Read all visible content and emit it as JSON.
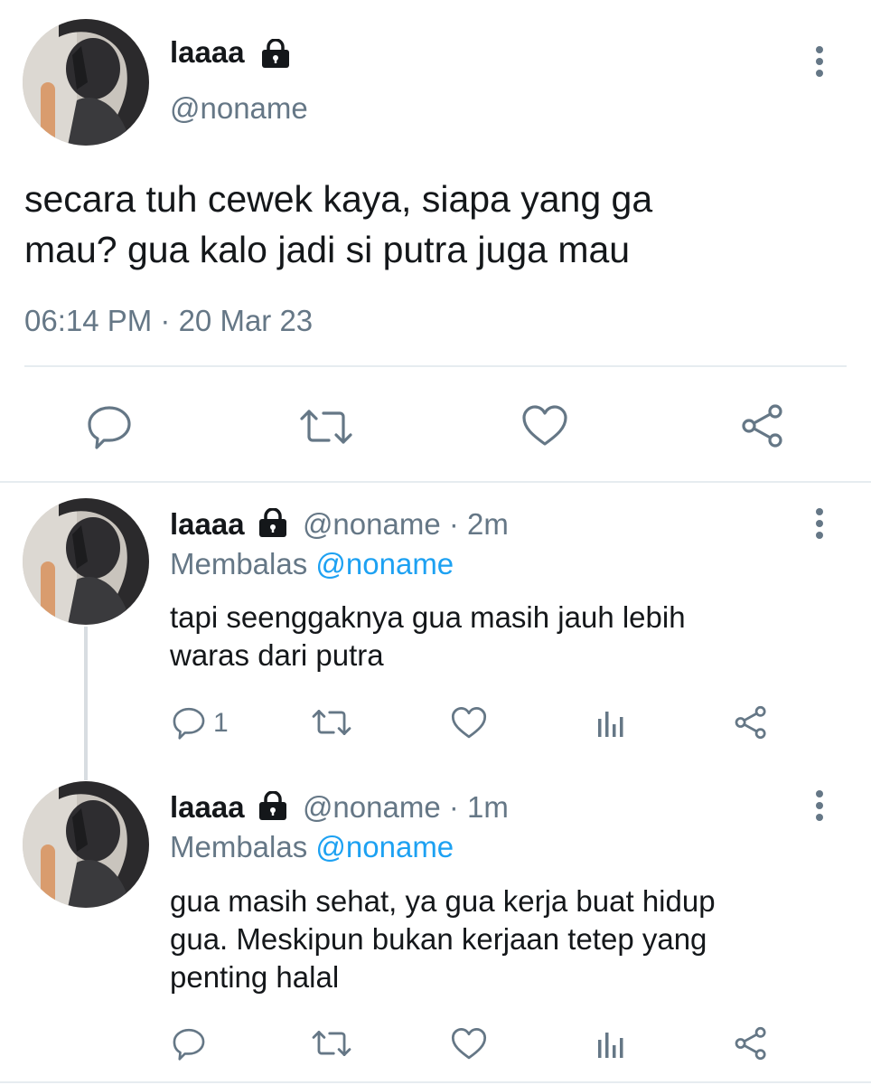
{
  "colors": {
    "text": "#14171a",
    "secondary": "#657786",
    "accent": "#1da1f2",
    "divider": "#e6ecf0"
  },
  "main_tweet": {
    "display_name": "laaaa",
    "handle": "@noname",
    "text_line1": "secara tuh cewek kaya, siapa yang ga",
    "text_line2": "mau? gua kalo jadi si putra juga mau",
    "timestamp": "06:14 PM · 20 Mar 23",
    "icons": [
      "reply-icon",
      "retweet-icon",
      "like-icon",
      "share-icon"
    ]
  },
  "replies": [
    {
      "display_name": "laaaa",
      "handle": "@noname",
      "time": "· 2m",
      "replying_prefix": "Membalas",
      "replying_to": "@noname",
      "text_line1": "tapi seenggaknya gua masih jauh lebih",
      "text_line2": "waras dari putra",
      "text_line3": "",
      "reply_count": "1"
    },
    {
      "display_name": "laaaa",
      "handle": "@noname",
      "time": "· 1m",
      "replying_prefix": "Membalas",
      "replying_to": "@noname",
      "text_line1": "gua masih sehat, ya gua kerja buat hidup",
      "text_line2": "gua. Meskipun bukan kerjaan tetep yang",
      "text_line3": "penting halal",
      "reply_count": ""
    }
  ]
}
